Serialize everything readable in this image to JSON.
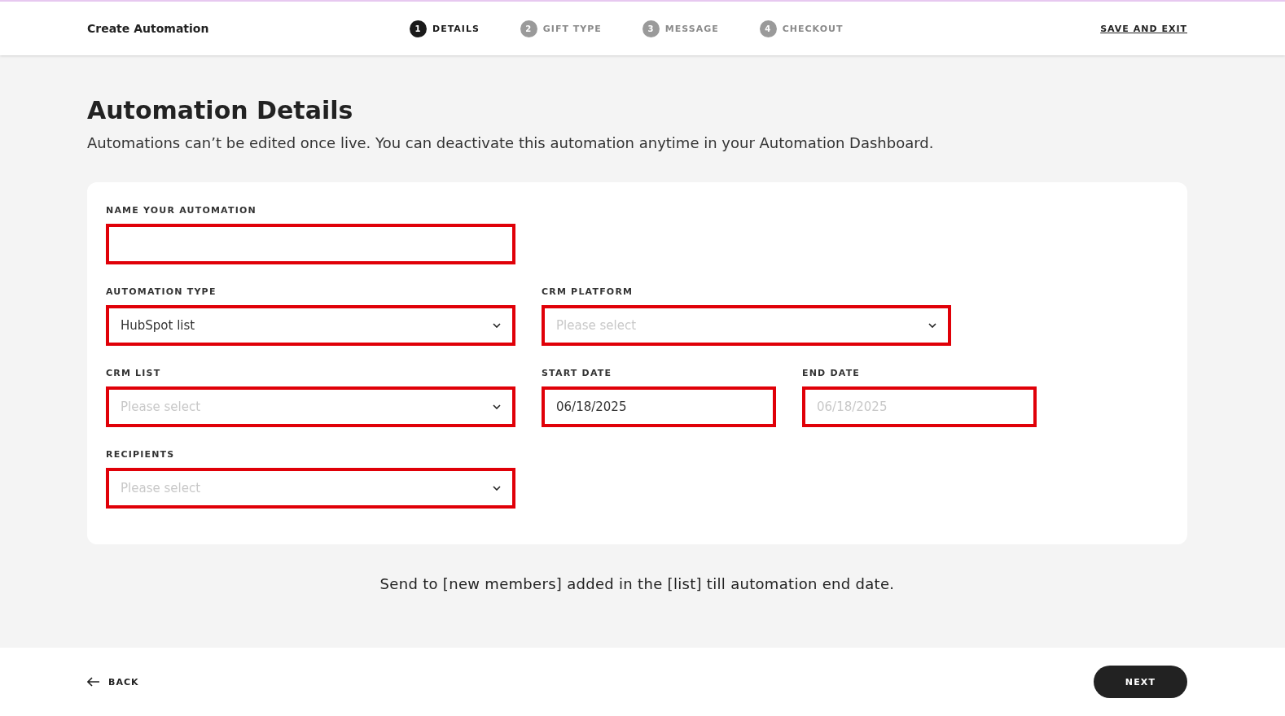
{
  "header": {
    "title": "Create Automation",
    "save_exit": "SAVE AND EXIT"
  },
  "steps": [
    {
      "number": "1",
      "label": "DETAILS",
      "selected": true
    },
    {
      "number": "2",
      "label": "GIFT TYPE",
      "selected": false
    },
    {
      "number": "3",
      "label": "MESSAGE",
      "selected": false
    },
    {
      "number": "4",
      "label": "CHECKOUT",
      "selected": false
    }
  ],
  "heading": "Automation Details",
  "subtitle": "Automations can’t be edited once live. You can deactivate this automation anytime in your Automation Dashboard.",
  "form_rows": [
    [
      {
        "label": "NAME YOUR AUTOMATION",
        "kind": "text"
      }
    ],
    [
      {
        "label": "AUTOMATION TYPE",
        "kind": "select",
        "value": "HubSpot list"
      },
      {
        "label": "CRM PLATFORM",
        "kind": "select",
        "placeholder": "Please select"
      }
    ],
    [
      {
        "label": "CRM LIST",
        "kind": "select",
        "placeholder": "Please select"
      },
      {
        "label": "START DATE",
        "kind": "date",
        "value": "06/18/2025"
      },
      {
        "label": "END DATE",
        "kind": "date",
        "placeholder": "06/18/2025"
      }
    ],
    [
      {
        "label": "RECIPIENTS",
        "kind": "select",
        "placeholder": "Please select"
      }
    ]
  ],
  "note": "Send to [new members] added in the [list] till automation end date.",
  "footer": {
    "back": "BACK",
    "next": "NEXT"
  }
}
